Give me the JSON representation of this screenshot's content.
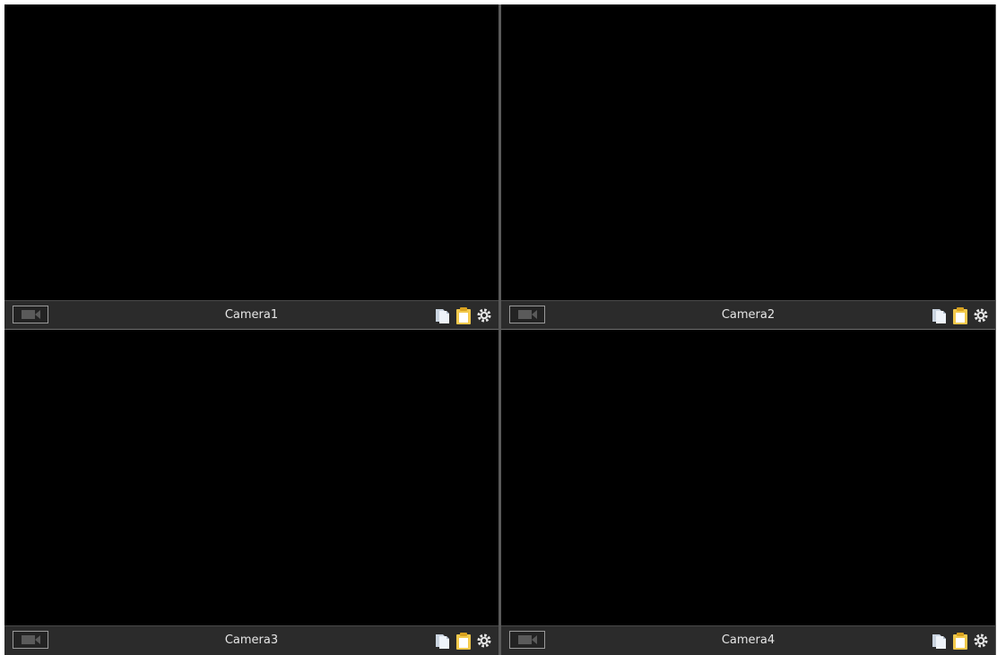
{
  "cameras": [
    {
      "label": "Camera1"
    },
    {
      "label": "Camera2"
    },
    {
      "label": "Camera3"
    },
    {
      "label": "Camera4"
    }
  ],
  "icons": {
    "record": "video-camera-icon",
    "copy": "copy-icon",
    "paste": "paste-icon",
    "settings": "gear-icon"
  },
  "colors": {
    "video_bg": "#000000",
    "toolbar_bg": "#2b2b2b",
    "label_text": "#e6e6e6",
    "paste_icon": "#f2c94c",
    "copy_icon": "#e8eef6"
  }
}
